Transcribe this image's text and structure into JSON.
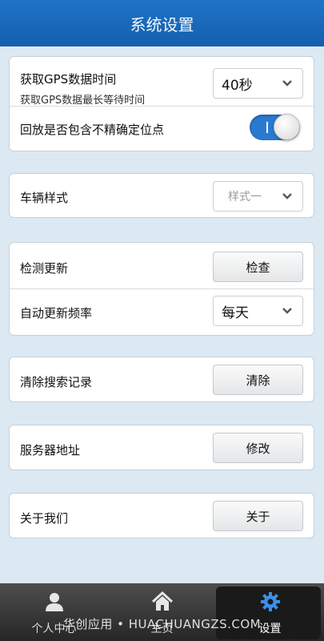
{
  "header": {
    "title": "系统设置"
  },
  "gps": {
    "label": "获取GPS数据时间",
    "sublabel": "获取GPS数据最长等待时间",
    "value": "40秒"
  },
  "playback": {
    "label": "回放是否包含不精确定位点",
    "toggle_on": true,
    "toggle_text": "I"
  },
  "vehicle_style": {
    "label": "车辆样式",
    "value": "样式一"
  },
  "update_check": {
    "label": "检测更新",
    "button": "检查"
  },
  "auto_update": {
    "label": "自动更新频率",
    "value": "每天"
  },
  "clear_search": {
    "label": "清除搜索记录",
    "button": "清除"
  },
  "server": {
    "label": "服务器地址",
    "button": "修改"
  },
  "about": {
    "label": "关于我们",
    "button": "关于"
  },
  "tabs": [
    {
      "label": "个人中心",
      "icon": "person-icon"
    },
    {
      "label": "主页",
      "icon": "home-icon"
    },
    {
      "label": "设置",
      "icon": "gear-icon",
      "active": true
    }
  ],
  "watermark": "华创应用 • HUACHUANGZS.COM",
  "colors": {
    "header": "#1a6bbf",
    "accent": "#2a7ad2",
    "page_bg": "#dde9f2",
    "active_icon": "#3d8fe6"
  }
}
